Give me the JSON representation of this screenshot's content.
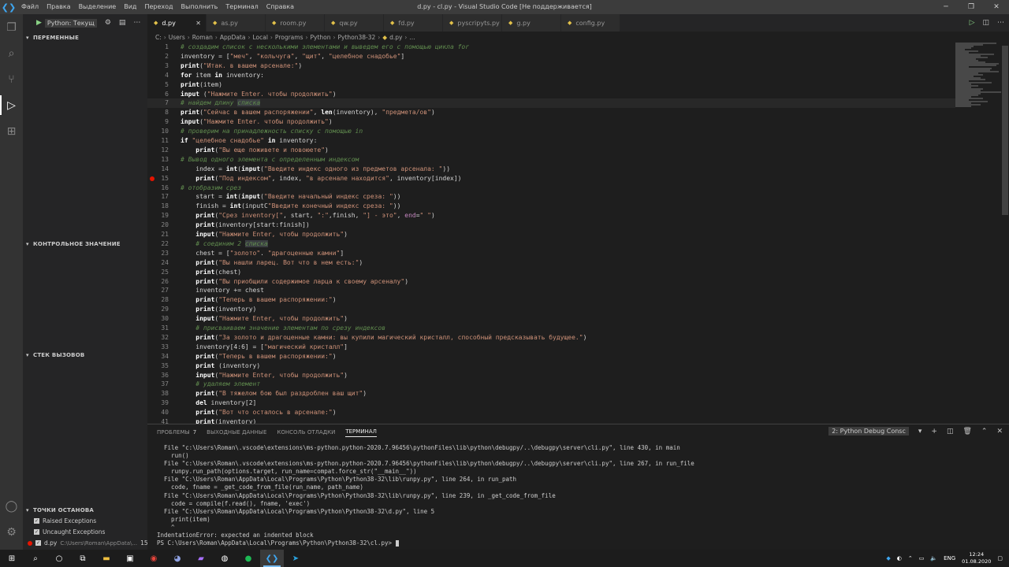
{
  "titlebar": {
    "menu": [
      "Файл",
      "Правка",
      "Выделение",
      "Вид",
      "Переход",
      "Выполнить",
      "Терминал",
      "Справка"
    ],
    "title": "d.py - cl.py - Visual Studio Code [Не поддерживается]"
  },
  "sidebar": {
    "run_config": "Python: Текущ",
    "sections": {
      "variables": "ПЕРЕМЕННЫЕ",
      "watch": "КОНТРОЛЬНОЕ ЗНАЧЕНИЕ",
      "callstack": "СТЕК ВЫЗОВОВ",
      "breakpoints": "ТОЧКИ ОСТАНОВА"
    },
    "breakpoints": [
      {
        "label": "Raised Exceptions",
        "checked": true
      },
      {
        "label": "Uncaught Exceptions",
        "checked": true
      },
      {
        "label": "d.py",
        "path": "C:\\Users\\Roman\\AppData\\...",
        "line": "15",
        "checked": true
      }
    ]
  },
  "tabs": [
    {
      "label": "d.py",
      "active": true
    },
    {
      "label": "as.py"
    },
    {
      "label": "room.py"
    },
    {
      "label": "qw.py"
    },
    {
      "label": "fd.py"
    },
    {
      "label": "pyscripyts.py"
    },
    {
      "label": "g.py"
    },
    {
      "label": "config.py"
    }
  ],
  "breadcrumb": [
    "C:",
    "Users",
    "Roman",
    "AppData",
    "Local",
    "Programs",
    "Python",
    "Python38-32",
    "d.py",
    "..."
  ],
  "editor": {
    "cursor_line": 7,
    "breakpoint_line": 15,
    "lines": [
      [
        [
          "c",
          "# создадим список с несколькими элементами и выведем его с помощью цикла for"
        ]
      ],
      [
        [
          "p",
          "inventory = ["
        ],
        [
          "s",
          "\"меч\""
        ],
        [
          "p",
          ", "
        ],
        [
          "s",
          "\"кольчуга\""
        ],
        [
          "p",
          ", "
        ],
        [
          "s",
          "\"щит\""
        ],
        [
          "p",
          ", "
        ],
        [
          "s",
          "\"целебное снадобье\""
        ],
        [
          "p",
          "]"
        ]
      ],
      [
        [
          "f",
          "print"
        ],
        [
          "p",
          "("
        ],
        [
          "s",
          "\"Итак. в вашем арсенале:\""
        ],
        [
          "p",
          ")"
        ]
      ],
      [
        [
          "k",
          "for"
        ],
        [
          "p",
          " item "
        ],
        [
          "k",
          "in"
        ],
        [
          "p",
          " inventory:"
        ]
      ],
      [
        [
          "f",
          "print"
        ],
        [
          "p",
          "(item)"
        ]
      ],
      [
        [
          "f",
          "input"
        ],
        [
          "p",
          " ("
        ],
        [
          "s",
          "\"Нажмите Enter. чтобы продолжить\""
        ],
        [
          "p",
          ")"
        ]
      ],
      [
        [
          "c",
          "# найдем длину "
        ],
        [
          "h",
          "списка"
        ]
      ],
      [
        [
          "f",
          "print"
        ],
        [
          "p",
          "("
        ],
        [
          "s",
          "\"Сейчас в вашем распоряжении\""
        ],
        [
          "p",
          ", "
        ],
        [
          "f",
          "len"
        ],
        [
          "p",
          "(inventory), "
        ],
        [
          "s",
          "\"предмета/ов\""
        ],
        [
          "p",
          ")"
        ]
      ],
      [
        [
          "f",
          "input"
        ],
        [
          "p",
          "("
        ],
        [
          "s",
          "\"Нажмите Enter. чтобы продолжить\""
        ],
        [
          "p",
          ")"
        ]
      ],
      [
        [
          "c",
          "# проверим на принадлежность списку с помощью in"
        ]
      ],
      [
        [
          "k",
          "if"
        ],
        [
          "p",
          " "
        ],
        [
          "s",
          "\"целебное снадобье\""
        ],
        [
          "p",
          " "
        ],
        [
          "k",
          "in"
        ],
        [
          "p",
          " inventory:"
        ]
      ],
      [
        [
          "p",
          "    "
        ],
        [
          "f",
          "print"
        ],
        [
          "p",
          "("
        ],
        [
          "s",
          "\"Вы еще поживете и повоюете\""
        ],
        [
          "p",
          ")"
        ]
      ],
      [
        [
          "c",
          "# Вывод одного элемента с определенным индексом"
        ]
      ],
      [
        [
          "p",
          "    index = "
        ],
        [
          "f",
          "int"
        ],
        [
          "p",
          "("
        ],
        [
          "f",
          "input"
        ],
        [
          "p",
          "("
        ],
        [
          "s",
          "\"Введите индекс одного из предметов арсенала: \""
        ],
        [
          "p",
          "))"
        ]
      ],
      [
        [
          "p",
          "    "
        ],
        [
          "f",
          "print"
        ],
        [
          "p",
          "("
        ],
        [
          "s",
          "\"Под индексом\""
        ],
        [
          "p",
          ", index, "
        ],
        [
          "s",
          "\"в арсенале находится\""
        ],
        [
          "p",
          ", inventory[index])"
        ]
      ],
      [
        [
          "c",
          "# отобразим срез"
        ]
      ],
      [
        [
          "p",
          "    start = "
        ],
        [
          "f",
          "int"
        ],
        [
          "p",
          "("
        ],
        [
          "f",
          "input"
        ],
        [
          "p",
          "("
        ],
        [
          "s",
          "\"Введите начальный индекс среза: \""
        ],
        [
          "p",
          "))"
        ]
      ],
      [
        [
          "p",
          "    finish = "
        ],
        [
          "f",
          "int"
        ],
        [
          "p",
          "(inputC"
        ],
        [
          "s",
          "\"Введите конечный индекс среза: \""
        ],
        [
          "p",
          "))"
        ]
      ],
      [
        [
          "p",
          "    "
        ],
        [
          "f",
          "print"
        ],
        [
          "p",
          "("
        ],
        [
          "s",
          "\"Срез inventory[\""
        ],
        [
          "p",
          ", start, "
        ],
        [
          "s",
          "\":\""
        ],
        [
          "p",
          ",finish, "
        ],
        [
          "s",
          "\"] - это\""
        ],
        [
          "p",
          ", "
        ],
        [
          "m",
          "end"
        ],
        [
          "p",
          "="
        ],
        [
          "s",
          "\" \""
        ],
        [
          "p",
          ")"
        ]
      ],
      [
        [
          "p",
          "    "
        ],
        [
          "f",
          "print"
        ],
        [
          "p",
          "(inventory[start:finish])"
        ]
      ],
      [
        [
          "p",
          "    "
        ],
        [
          "f",
          "input"
        ],
        [
          "p",
          "("
        ],
        [
          "s",
          "\"Нажмите Enter, чтобы продолжить\""
        ],
        [
          "p",
          ")"
        ]
      ],
      [
        [
          "p",
          "    "
        ],
        [
          "c",
          "# соединим 2 "
        ],
        [
          "h",
          "списка"
        ]
      ],
      [
        [
          "p",
          "    chest = ["
        ],
        [
          "s",
          "\"золото\""
        ],
        [
          "p",
          ". "
        ],
        [
          "s",
          "\"драгоценные камни\""
        ],
        [
          "p",
          "]"
        ]
      ],
      [
        [
          "p",
          "    "
        ],
        [
          "f",
          "print"
        ],
        [
          "p",
          "("
        ],
        [
          "s",
          "\"Вы нашли ларец. Вот что в нем есть:\""
        ],
        [
          "p",
          ")"
        ]
      ],
      [
        [
          "p",
          "    "
        ],
        [
          "f",
          "print"
        ],
        [
          "p",
          "(chest)"
        ]
      ],
      [
        [
          "p",
          "    "
        ],
        [
          "f",
          "print"
        ],
        [
          "p",
          "("
        ],
        [
          "s",
          "\"Вы приобщили содержимое ларца к своему арсеналу\""
        ],
        [
          "p",
          ")"
        ]
      ],
      [
        [
          "p",
          "    inventory += chest"
        ]
      ],
      [
        [
          "p",
          "    "
        ],
        [
          "f",
          "print"
        ],
        [
          "p",
          "("
        ],
        [
          "s",
          "\"Теперь в вашем распоряжении:\""
        ],
        [
          "p",
          ")"
        ]
      ],
      [
        [
          "p",
          "    "
        ],
        [
          "f",
          "print"
        ],
        [
          "p",
          "(inventory)"
        ]
      ],
      [
        [
          "p",
          "    "
        ],
        [
          "f",
          "input"
        ],
        [
          "p",
          "("
        ],
        [
          "s",
          "\"Нажмите Enter, чтобы продолжить\""
        ],
        [
          "p",
          ")"
        ]
      ],
      [
        [
          "p",
          "    "
        ],
        [
          "c",
          "# присваиваем значение элементам по срезу индексов"
        ]
      ],
      [
        [
          "p",
          "    "
        ],
        [
          "f",
          "print"
        ],
        [
          "p",
          "("
        ],
        [
          "s",
          "\"За золото и драгоценные камни: вы купили магический кристалл, способный предсказывать будущее.\""
        ],
        [
          "p",
          ")"
        ]
      ],
      [
        [
          "p",
          "    inventory[4:6] = ["
        ],
        [
          "s",
          "\"магический кристалл\""
        ],
        [
          "p",
          "]"
        ]
      ],
      [
        [
          "p",
          "    "
        ],
        [
          "f",
          "print"
        ],
        [
          "p",
          "("
        ],
        [
          "s",
          "\"Теперь в вашем распоряжении:\""
        ],
        [
          "p",
          ")"
        ]
      ],
      [
        [
          "p",
          "    "
        ],
        [
          "f",
          "print"
        ],
        [
          "p",
          " (inventory)"
        ]
      ],
      [
        [
          "p",
          "    "
        ],
        [
          "f",
          "input"
        ],
        [
          "p",
          "("
        ],
        [
          "s",
          "\"Нажмите Enter, чтобы продолжить\""
        ],
        [
          "p",
          ")"
        ]
      ],
      [
        [
          "p",
          "    "
        ],
        [
          "c",
          "# удаляем элемент"
        ]
      ],
      [
        [
          "p",
          "    "
        ],
        [
          "f",
          "print"
        ],
        [
          "p",
          "("
        ],
        [
          "s",
          "\"В тяжелом бою был раздроблен ваш щит\""
        ],
        [
          "p",
          ")"
        ]
      ],
      [
        [
          "p",
          "    "
        ],
        [
          "k",
          "del"
        ],
        [
          "p",
          " inventory[2]"
        ]
      ],
      [
        [
          "p",
          "    "
        ],
        [
          "f",
          "print"
        ],
        [
          "p",
          "("
        ],
        [
          "s",
          "\"Вот что осталось в арсенале:\""
        ],
        [
          "p",
          ")"
        ]
      ],
      [
        [
          "p",
          "    "
        ],
        [
          "f",
          "print"
        ],
        [
          "p",
          "(inventory)"
        ]
      ]
    ]
  },
  "panel": {
    "tabs": [
      {
        "label": "ПРОБЛЕМЫ",
        "badge": "7"
      },
      {
        "label": "ВЫХОДНЫЕ ДАННЫЕ"
      },
      {
        "label": "КОНСОЛЬ ОТЛАДКИ"
      },
      {
        "label": "ТЕРМИНАЛ",
        "active": true
      }
    ],
    "terminal_select": "2: Python Debug Consc",
    "terminal_lines": [
      "  File \"c:\\Users\\Roman\\.vscode\\extensions\\ms-python.python-2020.7.96456\\pythonFiles\\lib\\python\\debugpy/..\\debugpy\\server\\cli.py\", line 430, in main",
      "    run()",
      "  File \"c:\\Users\\Roman\\.vscode\\extensions\\ms-python.python-2020.7.96456\\pythonFiles\\lib\\python\\debugpy/..\\debugpy\\server\\cli.py\", line 267, in run_file",
      "    runpy.run_path(options.target, run_name=compat.force_str(\"__main__\"))",
      "  File \"C:\\Users\\Roman\\AppData\\Local\\Programs\\Python\\Python38-32\\lib\\runpy.py\", line 264, in run_path",
      "    code, fname = _get_code_from_file(run_name, path_name)",
      "  File \"C:\\Users\\Roman\\AppData\\Local\\Programs\\Python\\Python38-32\\lib\\runpy.py\", line 239, in _get_code_from_file",
      "    code = compile(f.read(), fname, 'exec')",
      "  File \"C:\\Users\\Roman\\AppData\\Local\\Programs\\Python\\Python38-32\\d.py\", line 5",
      "    print(item)",
      "    ^",
      "IndentationError: expected an indented block",
      "PS C:\\Users\\Roman\\AppData\\Local\\Programs\\Python\\Python38-32\\cl.py> "
    ]
  },
  "taskbar": {
    "lang": "ENG",
    "time": "12:24",
    "date": "01.08.2020"
  }
}
